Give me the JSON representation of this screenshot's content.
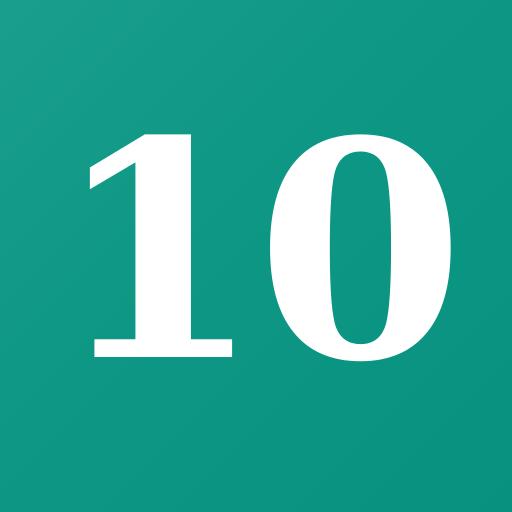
{
  "tile": {
    "number": "10",
    "background_color": "#0d9784",
    "text_color": "#ffffff"
  }
}
